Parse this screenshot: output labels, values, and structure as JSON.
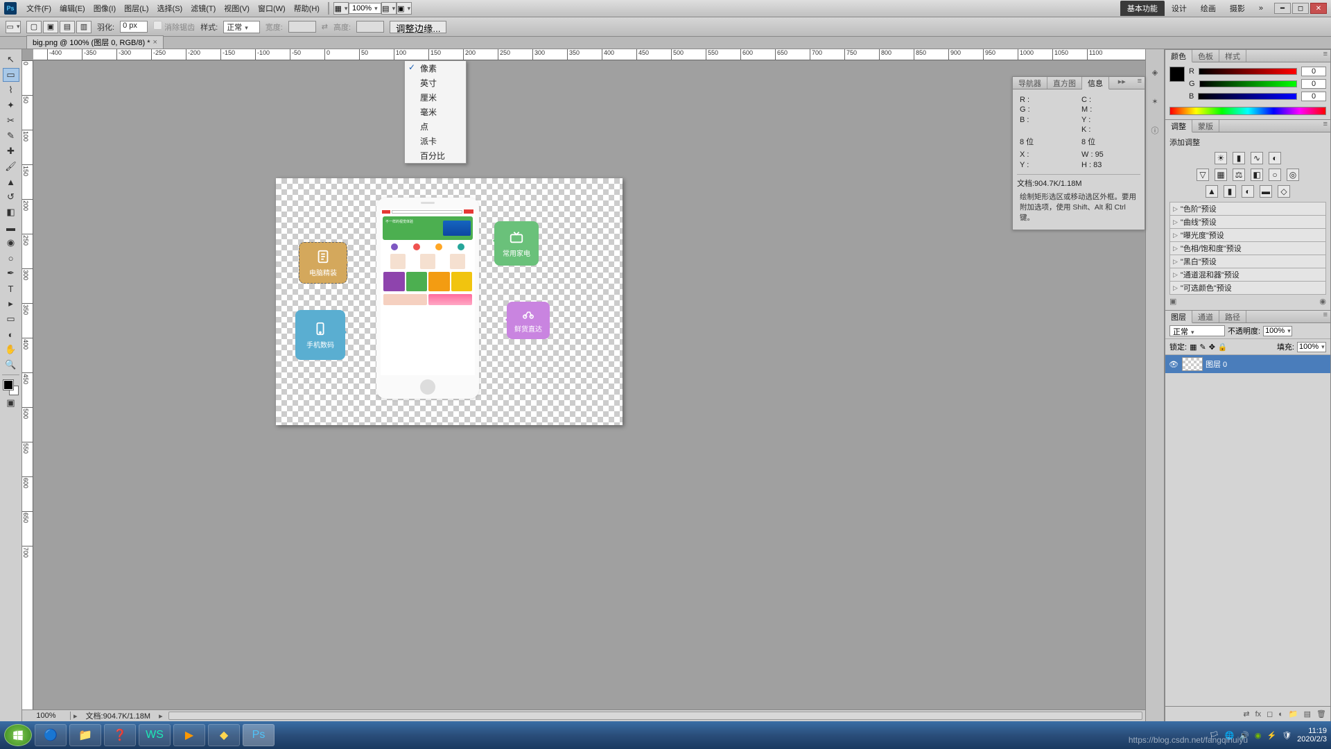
{
  "menu": {
    "items": [
      "文件(F)",
      "编辑(E)",
      "图像(I)",
      "图层(L)",
      "选择(S)",
      "滤镜(T)",
      "视图(V)",
      "窗口(W)",
      "帮助(H)"
    ],
    "zoom_percent": "100%"
  },
  "workspace": {
    "tabs": [
      "基本功能",
      "设计",
      "绘画",
      "摄影"
    ],
    "active_index": 0,
    "more": "»"
  },
  "options_bar": {
    "feather_label": "羽化:",
    "feather_value": "0 px",
    "antialias": "消除锯齿",
    "style_label": "样式:",
    "style_value": "正常",
    "width_label": "宽度:",
    "height_label": "高度:",
    "refine_edge": "调整边缘..."
  },
  "document": {
    "tab_title": "big.png @ 100% (图层 0, RGB/8) *",
    "status_zoom": "100%",
    "status_doc": "文档:904.7K/1.18M"
  },
  "ruler_units_menu": {
    "items": [
      "像素",
      "英寸",
      "厘米",
      "毫米",
      "点",
      "派卡",
      "百分比"
    ],
    "checked_index": 0
  },
  "canvas_bubbles": {
    "yellow": "电脑精装",
    "green": "常用家电",
    "blue": "手机数码",
    "purple": "鲜货直达"
  },
  "phone_banner_text": "不一样的视觉体验",
  "navigator_panel": {
    "tabs": [
      "导航器",
      "直方图",
      "信息"
    ],
    "active": 2,
    "R": "R :",
    "G": "G :",
    "B": "B :",
    "C": "C :",
    "M": "M :",
    "Y": "Y :",
    "K": "K :",
    "bits_left": "8 位",
    "bits_right": "8 位",
    "X": "X :",
    "Ycoord": "Y :",
    "W": "W :",
    "H": "H :",
    "W_val": "95",
    "H_val": "83",
    "doc_line": "文档:904.7K/1.18M",
    "hint": "绘制矩形选区或移动选区外框。要用附加选项，使用 Shift、Alt 和 Ctrl 键。"
  },
  "color_panel": {
    "tabs": [
      "颜色",
      "色板",
      "样式"
    ],
    "active": 0,
    "R": "R",
    "G": "G",
    "B": "B",
    "R_val": "0",
    "G_val": "0",
    "B_val": "0"
  },
  "adjustments_panel": {
    "tabs": [
      "调整",
      "蒙版"
    ],
    "active": 0,
    "title": "添加调整",
    "presets": [
      "\"色阶\"预设",
      "\"曲线\"预设",
      "\"曝光度\"预设",
      "\"色相/饱和度\"预设",
      "\"黑白\"预设",
      "\"通道混和器\"预设",
      "\"可选颜色\"预设"
    ]
  },
  "layers_panel": {
    "tabs": [
      "图层",
      "通道",
      "路径"
    ],
    "active": 0,
    "blend_mode": "正常",
    "opacity_label": "不透明度:",
    "opacity_value": "100%",
    "lock_label": "锁定:",
    "fill_label": "填充:",
    "fill_value": "100%",
    "layer_name": "图层 0"
  },
  "taskbar": {
    "time": "11:19",
    "date": "2020/2/3"
  },
  "watermark": "https://blog.csdn.net/fangqihuiyu"
}
